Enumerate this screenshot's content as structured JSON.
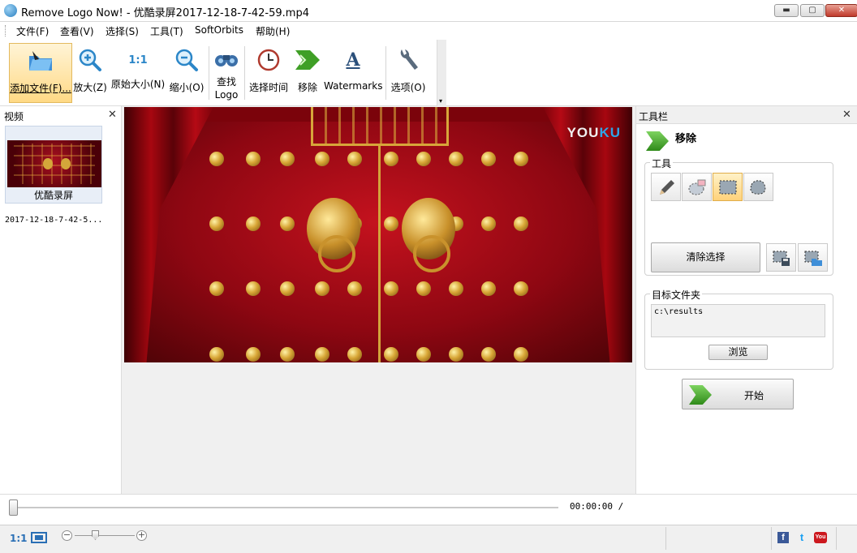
{
  "window": {
    "title": "Remove Logo Now! - 优酷录屏2017-12-18-7-42-59.mp4",
    "min_label": "▬",
    "max_label": "▢",
    "close_label": "✕"
  },
  "menu": [
    "文件(F)",
    "查看(V)",
    "选择(S)",
    "工具(T)",
    "SoftOrbits",
    "帮助(H)"
  ],
  "toolbar": {
    "add_file": "添加文件(F)...",
    "zoom_in": "放大(Z)",
    "original_size": "原始大小(N)",
    "original_size_glyph": "1:1",
    "zoom_out": "缩小(O)",
    "find_logo_line1": "查找",
    "find_logo_line2": "Logo",
    "select_time": "选择时间",
    "remove": "移除",
    "watermarks": "Watermarks",
    "watermarks_glyph": "A",
    "options": "选项(O)",
    "overflow": "▾"
  },
  "video_panel": {
    "title": "视频",
    "close": "✕",
    "items": [
      {
        "name": "优酷录屏",
        "date": "2017-12-18-7-42-5..."
      }
    ]
  },
  "preview": {
    "watermark_you": "YOU",
    "watermark_ku": "KU"
  },
  "tool_panel": {
    "title": "工具栏",
    "close": "✕",
    "heading": "移除",
    "tools_group": "工具",
    "clear_selection": "清除选择",
    "target_group": "目标文件夹",
    "target_path": "c:\\results",
    "browse": "浏览",
    "start": "开始"
  },
  "player": {
    "timecode": "00:00:00  /",
    "progress": 0
  },
  "status": {
    "ratio": "1:1",
    "zoom_minus": "−",
    "zoom_plus": "+",
    "facebook": "f",
    "twitter": "t",
    "youtube": "You"
  },
  "colors": {
    "accent_blue": "#2a6fb5",
    "selection_orange": "#ffd985",
    "remove_arrow_green": "#2f8a1a"
  }
}
